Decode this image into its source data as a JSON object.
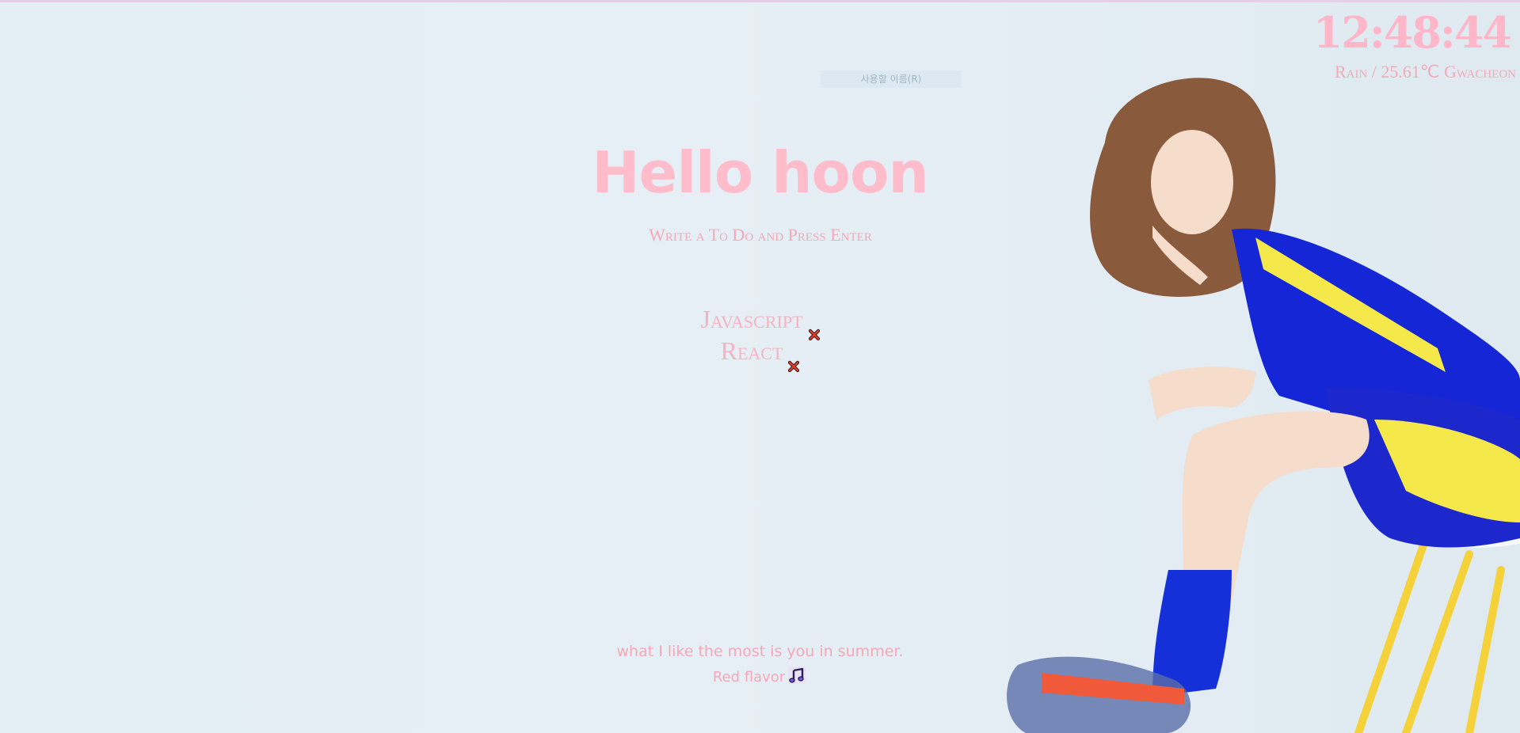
{
  "clock": {
    "time": "12:48:44"
  },
  "weather": {
    "text": "Rain / 25.61℃ Gwacheon"
  },
  "name_form": {
    "placeholder": "사용할 이름(R)"
  },
  "greeting": {
    "text": "Hello hoon"
  },
  "todo_form": {
    "placeholder": "Write a To Do and Press Enter"
  },
  "todos": [
    {
      "text": "Javascript"
    },
    {
      "text": "React"
    }
  ],
  "quote": {
    "text": "what I like the most is you in summer.",
    "author": "Red flavor"
  },
  "icons": {
    "delete": "close-x-icon",
    "music": "music-note-icon"
  },
  "colors": {
    "accent_pink": "#ffb6c8",
    "background": "#e4eef5"
  }
}
